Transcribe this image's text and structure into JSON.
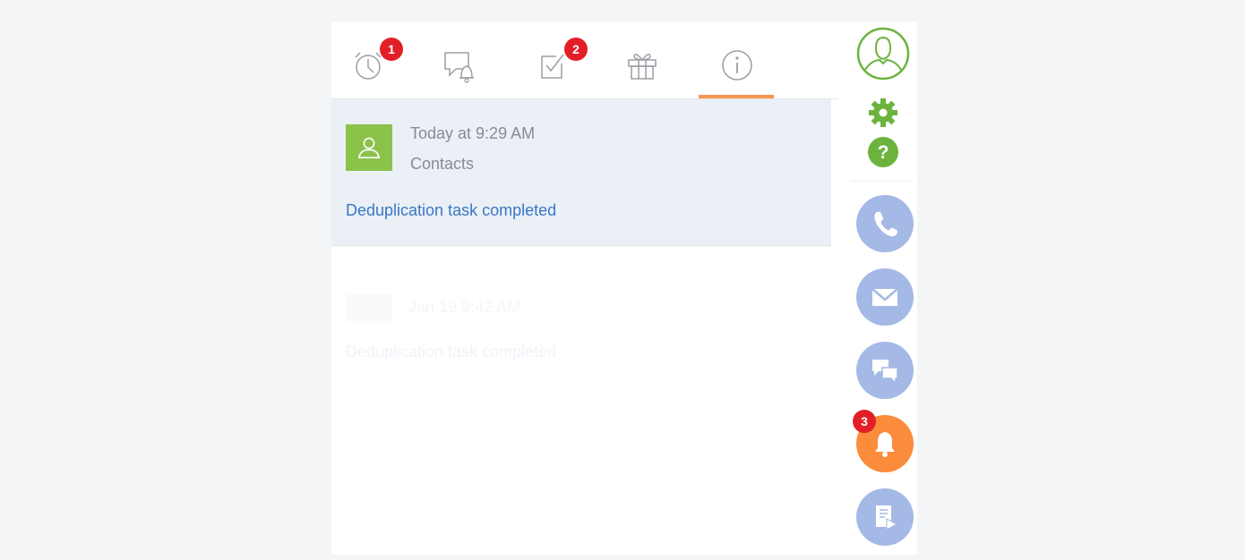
{
  "tabs": {
    "items": [
      {
        "name": "reminders",
        "icon": "alarm-clock-icon",
        "badge": "1"
      },
      {
        "name": "notifications",
        "icon": "chat-bell-icon",
        "badge": ""
      },
      {
        "name": "tasks",
        "icon": "checkbox-icon",
        "badge": "2"
      },
      {
        "name": "birthdays",
        "icon": "gift-icon",
        "badge": ""
      },
      {
        "name": "system-info",
        "icon": "info-icon",
        "badge": "",
        "active": true
      }
    ]
  },
  "notification": {
    "time": "Today at 9:29 AM",
    "section": "Contacts",
    "message": "Deduplication task completed"
  },
  "ghost_notification": {
    "time": "Jan 19 9:42 AM",
    "message": "Deduplication task completed"
  },
  "sidebar": {
    "profile_icon": "user-profile-icon",
    "settings_icon": "gear-icon",
    "help_icon": "help-icon",
    "phone_icon": "phone-icon",
    "email_icon": "envelope-icon",
    "chat_icon": "chat-icon",
    "notifications_icon": "bell-icon",
    "notifications_badge": "3",
    "process_icon": "process-icon"
  },
  "colors": {
    "accent": "#f5964f",
    "badge": "#e21f26",
    "side_button": "#a4b9e6",
    "notify_button": "#fb8c3c",
    "green": "#8bc34a",
    "link": "#3a76c4",
    "notification_bg": "#eaf0f6"
  }
}
